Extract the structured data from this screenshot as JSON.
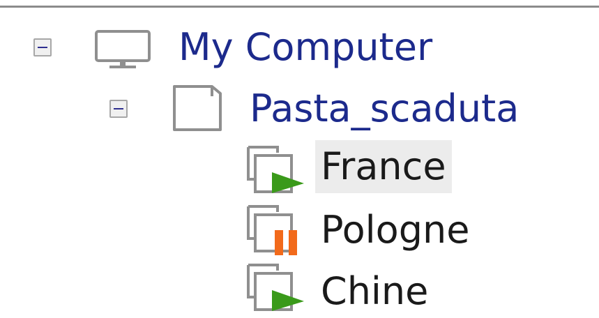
{
  "tree": {
    "root": {
      "label": "My Computer",
      "icon": "monitor-icon",
      "expanded": true
    },
    "folder": {
      "label": "Pasta_scaduta",
      "icon": "document-icon",
      "expanded": true
    },
    "items": [
      {
        "label": "France",
        "icon": "job-running-icon",
        "status": "running",
        "selected": true
      },
      {
        "label": "Pologne",
        "icon": "job-paused-icon",
        "status": "paused",
        "selected": false
      },
      {
        "label": "Chine",
        "icon": "job-running-icon",
        "status": "running",
        "selected": false
      }
    ],
    "colors": {
      "running": "#3a9a1a",
      "paused": "#f26a1b",
      "label_blue": "#1c2a8c"
    }
  }
}
